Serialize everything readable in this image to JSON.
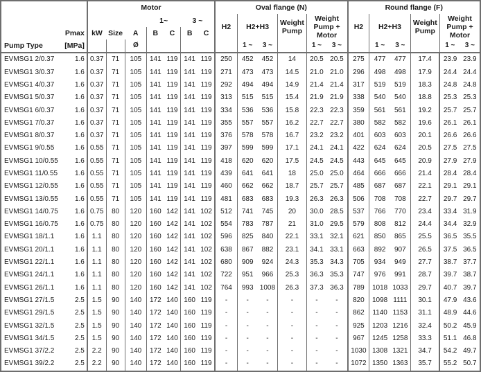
{
  "headers": {
    "pump_type": "Pump Type",
    "pmax": "Pmax",
    "pmax_unit": "[MPa]",
    "motor": "Motor",
    "kw": "kW",
    "size": "Size",
    "a": "A",
    "a_sub": "Ø",
    "one_phase": "1~",
    "three_phase": "3 ~",
    "b": "B",
    "c": "C",
    "oval_flange": "Oval flange (N)",
    "round_flange": "Round flange (F)",
    "h2": "H2",
    "h2h3": "H2+H3",
    "weight_pump": "Weight Pump",
    "weight_pump_motor": "Weight Pump + Motor",
    "sub_1": "1 ~",
    "sub_3": "3 ~"
  },
  "columns": [
    "pump_type",
    "pmax",
    "kw",
    "size",
    "a",
    "b1",
    "c1",
    "b3",
    "c3",
    "oval_h2",
    "oval_h2h3_1",
    "oval_h2h3_3",
    "oval_weight_pump",
    "oval_wpm_1",
    "oval_wpm_3",
    "round_h2",
    "round_h2h3_1",
    "round_h2h3_3",
    "round_weight_pump",
    "round_wpm_1",
    "round_wpm_3"
  ],
  "rows": [
    [
      "EVMSG1 2/0.37",
      "1.6",
      "0.37",
      "71",
      "105",
      "141",
      "119",
      "141",
      "119",
      "250",
      "452",
      "452",
      "14",
      "20.5",
      "20.5",
      "275",
      "477",
      "477",
      "17.4",
      "23.9",
      "23.9"
    ],
    [
      "EVMSG1 3/0.37",
      "1.6",
      "0.37",
      "71",
      "105",
      "141",
      "119",
      "141",
      "119",
      "271",
      "473",
      "473",
      "14.5",
      "21.0",
      "21.0",
      "296",
      "498",
      "498",
      "17.9",
      "24.4",
      "24.4"
    ],
    [
      "EVMSG1 4/0.37",
      "1.6",
      "0.37",
      "71",
      "105",
      "141",
      "119",
      "141",
      "119",
      "292",
      "494",
      "494",
      "14.9",
      "21.4",
      "21.4",
      "317",
      "519",
      "519",
      "18.3",
      "24.8",
      "24.8"
    ],
    [
      "EVMSG1 5/0.37",
      "1.6",
      "0.37",
      "71",
      "105",
      "141",
      "119",
      "141",
      "119",
      "313",
      "515",
      "515",
      "15.4",
      "21.9",
      "21.9",
      "338",
      "540",
      "540",
      "18.8",
      "25.3",
      "25.3"
    ],
    [
      "EVMSG1 6/0.37",
      "1.6",
      "0.37",
      "71",
      "105",
      "141",
      "119",
      "141",
      "119",
      "334",
      "536",
      "536",
      "15.8",
      "22.3",
      "22.3",
      "359",
      "561",
      "561",
      "19.2",
      "25.7",
      "25.7"
    ],
    [
      "EVMSG1 7/0.37",
      "1.6",
      "0.37",
      "71",
      "105",
      "141",
      "119",
      "141",
      "119",
      "355",
      "557",
      "557",
      "16.2",
      "22.7",
      "22.7",
      "380",
      "582",
      "582",
      "19.6",
      "26.1",
      "26.1"
    ],
    [
      "EVMSG1 8/0.37",
      "1.6",
      "0.37",
      "71",
      "105",
      "141",
      "119",
      "141",
      "119",
      "376",
      "578",
      "578",
      "16.7",
      "23.2",
      "23.2",
      "401",
      "603",
      "603",
      "20.1",
      "26.6",
      "26.6"
    ],
    [
      "EVMSG1 9/0.55",
      "1.6",
      "0.55",
      "71",
      "105",
      "141",
      "119",
      "141",
      "119",
      "397",
      "599",
      "599",
      "17.1",
      "24.1",
      "24.1",
      "422",
      "624",
      "624",
      "20.5",
      "27.5",
      "27.5"
    ],
    [
      "EVMSG1 10/0.55",
      "1.6",
      "0.55",
      "71",
      "105",
      "141",
      "119",
      "141",
      "119",
      "418",
      "620",
      "620",
      "17.5",
      "24.5",
      "24.5",
      "443",
      "645",
      "645",
      "20.9",
      "27.9",
      "27.9"
    ],
    [
      "EVMSG1 11/0.55",
      "1.6",
      "0.55",
      "71",
      "105",
      "141",
      "119",
      "141",
      "119",
      "439",
      "641",
      "641",
      "18",
      "25.0",
      "25.0",
      "464",
      "666",
      "666",
      "21.4",
      "28.4",
      "28.4"
    ],
    [
      "EVMSG1 12/0.55",
      "1.6",
      "0.55",
      "71",
      "105",
      "141",
      "119",
      "141",
      "119",
      "460",
      "662",
      "662",
      "18.7",
      "25.7",
      "25.7",
      "485",
      "687",
      "687",
      "22.1",
      "29.1",
      "29.1"
    ],
    [
      "EVMSG1 13/0.55",
      "1.6",
      "0.55",
      "71",
      "105",
      "141",
      "119",
      "141",
      "119",
      "481",
      "683",
      "683",
      "19.3",
      "26.3",
      "26.3",
      "506",
      "708",
      "708",
      "22.7",
      "29.7",
      "29.7"
    ],
    [
      "EVMSG1 14/0.75",
      "1.6",
      "0.75",
      "80",
      "120",
      "160",
      "142",
      "141",
      "102",
      "512",
      "741",
      "745",
      "20",
      "30.0",
      "28.5",
      "537",
      "766",
      "770",
      "23.4",
      "33.4",
      "31.9"
    ],
    [
      "EVMSG1 16/0.75",
      "1.6",
      "0.75",
      "80",
      "120",
      "160",
      "142",
      "141",
      "102",
      "554",
      "783",
      "787",
      "21",
      "31.0",
      "29.5",
      "579",
      "808",
      "812",
      "24.4",
      "34.4",
      "32.9"
    ],
    [
      "EVMSG1 18/1.1",
      "1.6",
      "1.1",
      "80",
      "120",
      "160",
      "142",
      "141",
      "102",
      "596",
      "825",
      "840",
      "22.1",
      "33.1",
      "32.1",
      "621",
      "850",
      "865",
      "25.5",
      "36.5",
      "35.5"
    ],
    [
      "EVMSG1 20/1.1",
      "1.6",
      "1.1",
      "80",
      "120",
      "160",
      "142",
      "141",
      "102",
      "638",
      "867",
      "882",
      "23.1",
      "34.1",
      "33.1",
      "663",
      "892",
      "907",
      "26.5",
      "37.5",
      "36.5"
    ],
    [
      "EVMSG1 22/1.1",
      "1.6",
      "1.1",
      "80",
      "120",
      "160",
      "142",
      "141",
      "102",
      "680",
      "909",
      "924",
      "24.3",
      "35.3",
      "34.3",
      "705",
      "934",
      "949",
      "27.7",
      "38.7",
      "37.7"
    ],
    [
      "EVMSG1 24/1.1",
      "1.6",
      "1.1",
      "80",
      "120",
      "160",
      "142",
      "141",
      "102",
      "722",
      "951",
      "966",
      "25.3",
      "36.3",
      "35.3",
      "747",
      "976",
      "991",
      "28.7",
      "39.7",
      "38.7"
    ],
    [
      "EVMSG1 26/1.1",
      "1.6",
      "1.1",
      "80",
      "120",
      "160",
      "142",
      "141",
      "102",
      "764",
      "993",
      "1008",
      "26.3",
      "37.3",
      "36.3",
      "789",
      "1018",
      "1033",
      "29.7",
      "40.7",
      "39.7"
    ],
    [
      "EVMSG1 27/1.5",
      "2.5",
      "1.5",
      "90",
      "140",
      "172",
      "140",
      "160",
      "119",
      "-",
      "-",
      "-",
      "-",
      "-",
      "-",
      "820",
      "1098",
      "1111",
      "30.1",
      "47.9",
      "43.6"
    ],
    [
      "EVMSG1 29/1.5",
      "2.5",
      "1.5",
      "90",
      "140",
      "172",
      "140",
      "160",
      "119",
      "-",
      "-",
      "-",
      "-",
      "-",
      "-",
      "862",
      "1140",
      "1153",
      "31.1",
      "48.9",
      "44.6"
    ],
    [
      "EVMSG1 32/1.5",
      "2.5",
      "1.5",
      "90",
      "140",
      "172",
      "140",
      "160",
      "119",
      "-",
      "-",
      "-",
      "-",
      "-",
      "-",
      "925",
      "1203",
      "1216",
      "32.4",
      "50.2",
      "45.9"
    ],
    [
      "EVMSG1 34/1.5",
      "2.5",
      "1.5",
      "90",
      "140",
      "172",
      "140",
      "160",
      "119",
      "-",
      "-",
      "-",
      "-",
      "-",
      "-",
      "967",
      "1245",
      "1258",
      "33.3",
      "51.1",
      "46.8"
    ],
    [
      "EVMSG1 37/2.2",
      "2.5",
      "2.2",
      "90",
      "140",
      "172",
      "140",
      "160",
      "119",
      "-",
      "-",
      "-",
      "-",
      "-",
      "-",
      "1030",
      "1308",
      "1321",
      "34.7",
      "54.2",
      "49.7"
    ],
    [
      "EVMSG1 39/2.2",
      "2.5",
      "2.2",
      "90",
      "140",
      "172",
      "140",
      "160",
      "119",
      "-",
      "-",
      "-",
      "-",
      "-",
      "-",
      "1072",
      "1350",
      "1363",
      "35.7",
      "55.2",
      "50.7"
    ]
  ]
}
